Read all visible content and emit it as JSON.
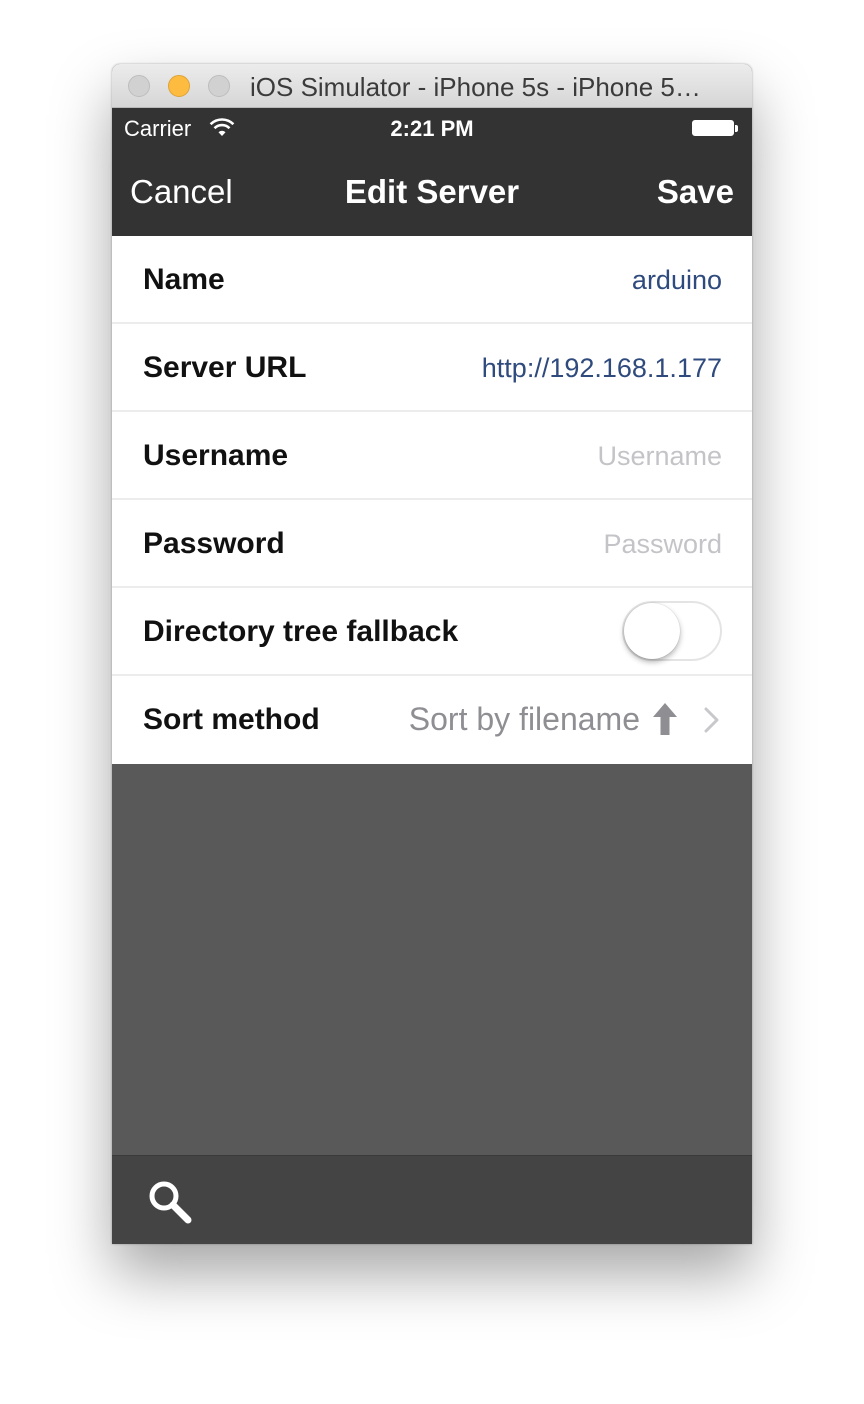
{
  "window": {
    "title": "iOS Simulator - iPhone 5s - iPhone 5…"
  },
  "status_bar": {
    "carrier": "Carrier",
    "time": "2:21 PM"
  },
  "nav": {
    "cancel_label": "Cancel",
    "title": "Edit Server",
    "save_label": "Save"
  },
  "form": {
    "name": {
      "label": "Name",
      "value": "arduino",
      "placeholder": ""
    },
    "server_url": {
      "label": "Server URL",
      "value": "http://192.168.1.177",
      "placeholder": ""
    },
    "username": {
      "label": "Username",
      "value": "",
      "placeholder": "Username"
    },
    "password": {
      "label": "Password",
      "value": "",
      "placeholder": "Password"
    },
    "directory_tree_fallback": {
      "label": "Directory tree fallback",
      "enabled": false
    },
    "sort_method": {
      "label": "Sort method",
      "value": "Sort by filename"
    }
  },
  "icons": {
    "wifi": "wifi-icon",
    "battery": "battery-icon",
    "sort_direction": "arrow-up-icon",
    "disclosure": "chevron-right-icon",
    "search": "search-icon"
  },
  "colors": {
    "bar_background": "#333333",
    "toolbar_background": "#444444",
    "content_background": "#595959",
    "input_text": "#2f4a7c",
    "placeholder_text": "#c4c4c8",
    "secondary_text": "#8e8e93",
    "traffic_minimize": "#fdbc40"
  }
}
